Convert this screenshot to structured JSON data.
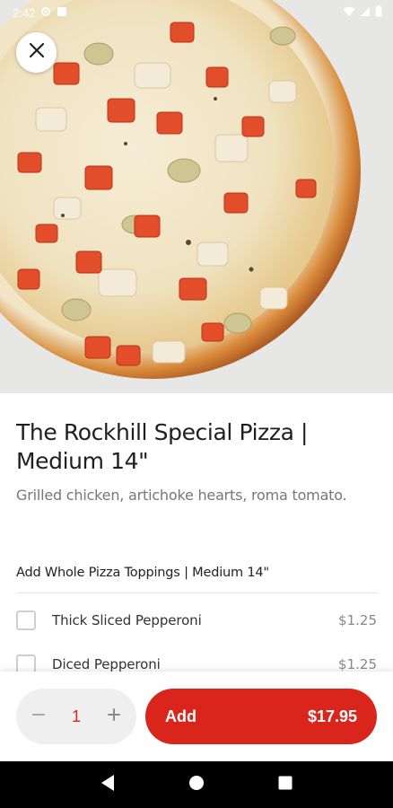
{
  "status_bar": {
    "time": "2:42",
    "icons": [
      "gear-icon",
      "notification-icon",
      "wifi-icon",
      "signal-icon",
      "battery-icon"
    ]
  },
  "hero": {
    "image": "pizza-photo",
    "close_icon": "close-icon"
  },
  "item": {
    "title": "The Rockhill Special Pizza | Medium 14\"",
    "description": "Grilled chicken, artichoke hearts, roma tomato."
  },
  "options_section": {
    "header": "Add Whole Pizza Toppings | Medium 14\"",
    "options": [
      {
        "name": "Thick Sliced Pepperoni",
        "price": "$1.25"
      },
      {
        "name": "Diced Pepperoni",
        "price": "$1.25"
      }
    ]
  },
  "action_bar": {
    "quantity": "1",
    "minus_icon": "minus-icon",
    "plus_icon": "plus-icon",
    "add_label": "Add",
    "total": "$17.95"
  },
  "colors": {
    "accent": "#d9251c",
    "text_primary": "#1f1f1f",
    "text_secondary": "#777777",
    "stepper_bg": "#efefef"
  },
  "nav_bar": {
    "icons": [
      "back-icon",
      "home-icon",
      "recents-icon"
    ]
  }
}
